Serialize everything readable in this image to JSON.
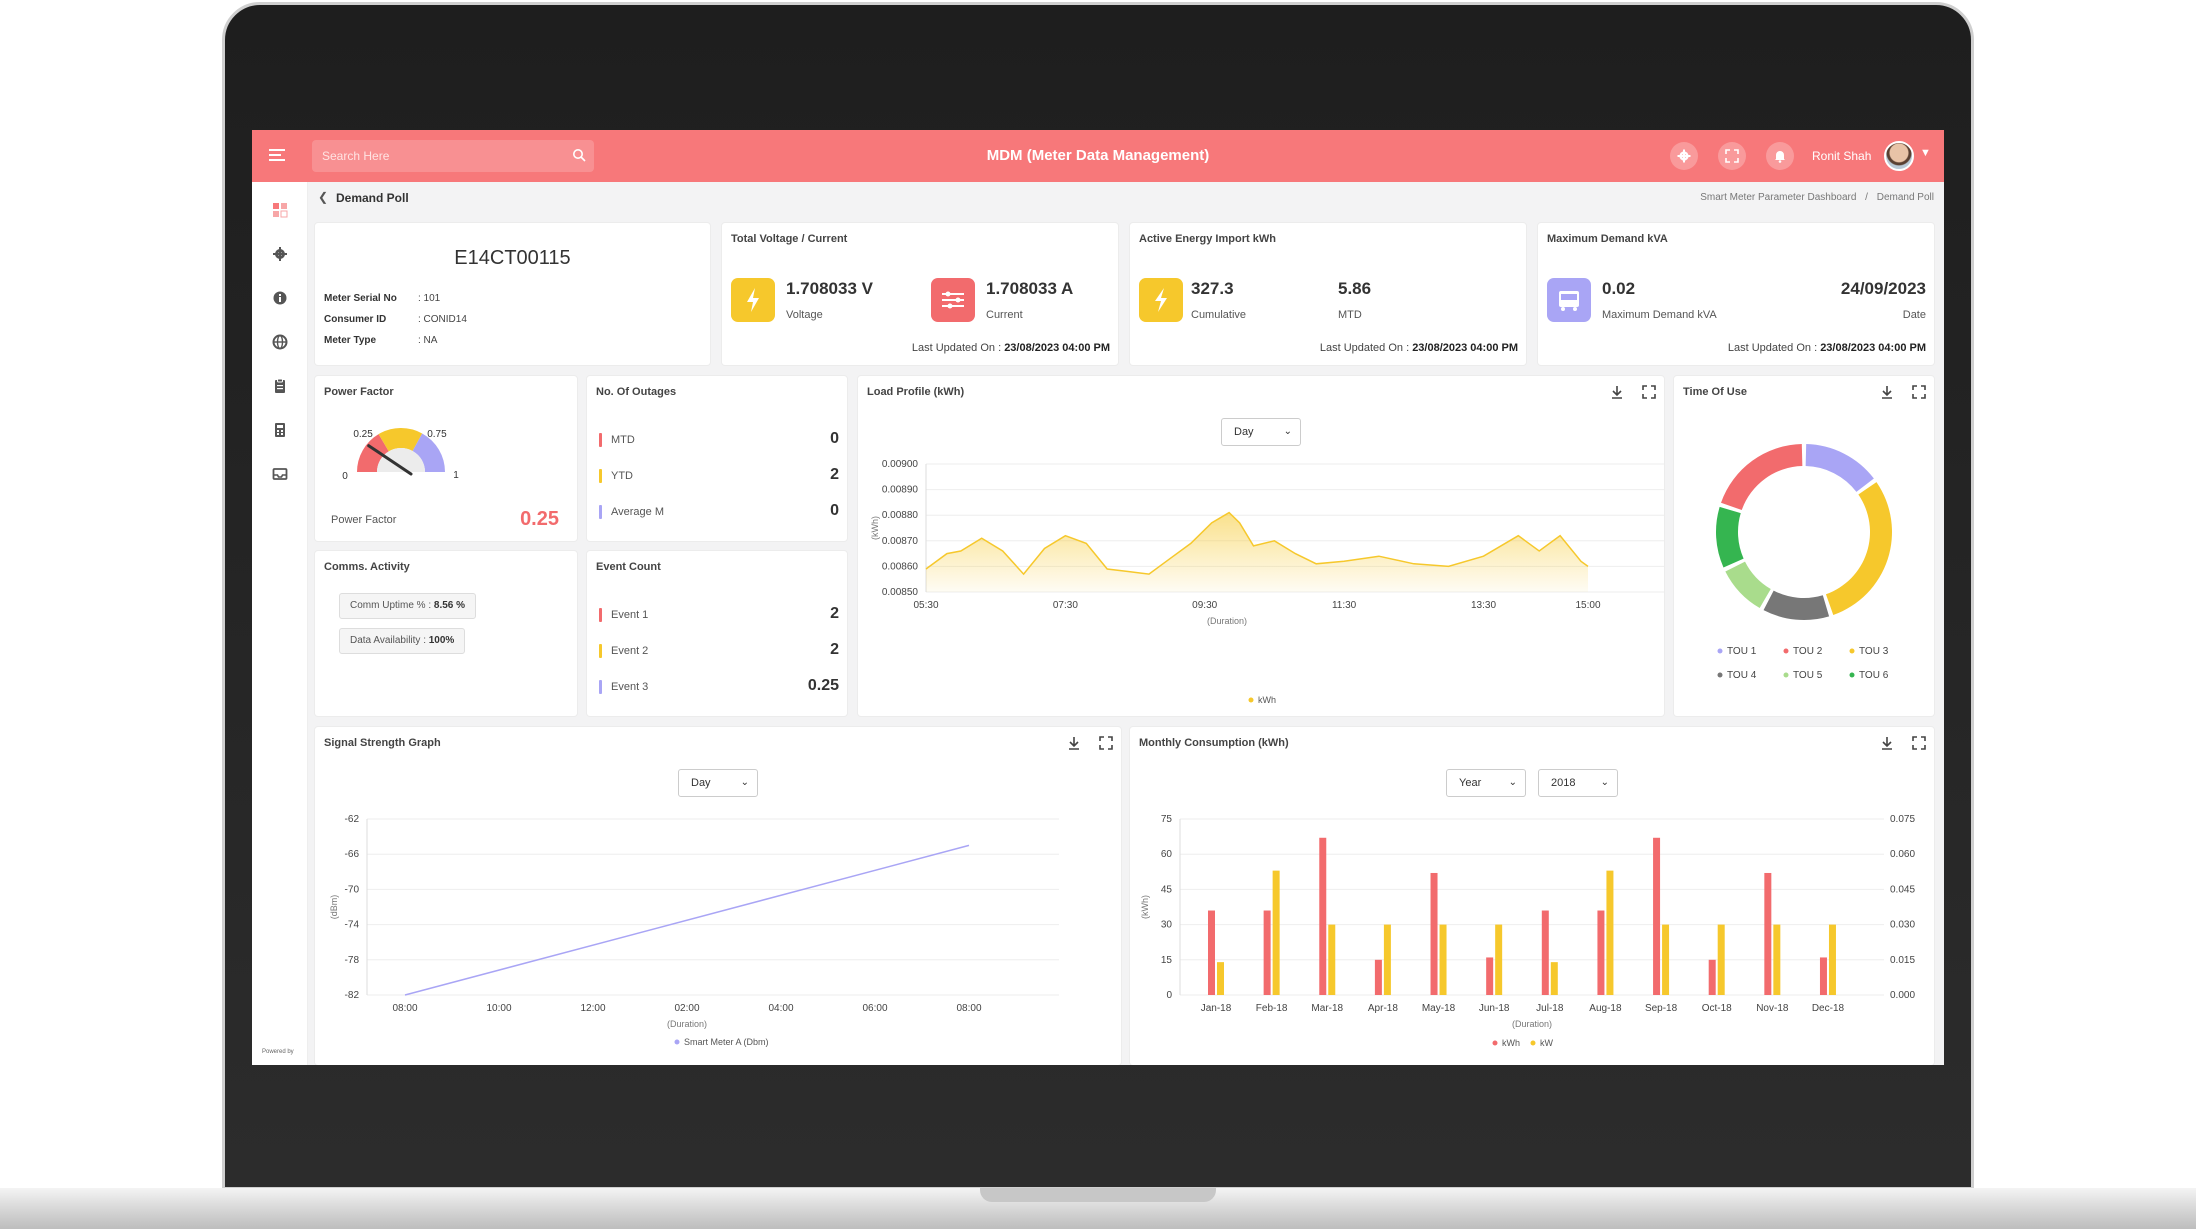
{
  "app": {
    "title": "MDM (Meter Data Management)",
    "search_placeholder": "Search Here",
    "user_name": "Ronit Shah",
    "page_title": "Demand Poll",
    "breadcrumb": [
      "Smart Meter Parameter Dashboard",
      "/",
      "Demand Poll"
    ],
    "powered_by": "Powered by",
    "icons": {
      "menu": "hamburger-menu-icon",
      "search": "search-icon",
      "settings": "gear-icon",
      "fullscreen": "fullscreen-icon",
      "notifications": "bell-icon",
      "dropdown": "chevron-down-icon",
      "back": "chevron-left-icon",
      "sidebar": [
        "dashboard-icon",
        "gear-icon",
        "info-icon",
        "globe-icon",
        "clipboard-icon",
        "calculator-icon",
        "inbox-icon"
      ]
    }
  },
  "colors": {
    "accent": "#f7787a",
    "yellow": "#f6c82c",
    "red": "#f26b6d",
    "purple": "#a9a5f5",
    "green": "#35b550",
    "lightgreen": "#a9dc8c",
    "gray": "#777777"
  },
  "meter": {
    "serial_title": "E14CT00115",
    "fields": [
      {
        "label": "Meter Serial No",
        "value": ": 101"
      },
      {
        "label": "Consumer ID",
        "value": ": CONID14"
      },
      {
        "label": "Meter Type",
        "value": ": NA"
      }
    ]
  },
  "voltage_card": {
    "title": "Total Voltage / Current",
    "voltage_value": "1.708033 V",
    "voltage_label": "Voltage",
    "current_value": "1.708033 A",
    "current_label": "Current",
    "updated_label": "Last Updated On :",
    "updated_value": "23/08/2023 04:00 PM"
  },
  "energy_card": {
    "title": "Active Energy Import kWh",
    "cumulative_value": "327.3",
    "cumulative_label": "Cumulative",
    "mtd_value": "5.86",
    "mtd_label": "MTD",
    "updated_label": "Last Updated On :",
    "updated_value": "23/08/2023 04:00 PM"
  },
  "demand_card": {
    "title": "Maximum Demand kVA",
    "value": "0.02",
    "value_label": "Maximum Demand kVA",
    "date_value": "24/09/2023",
    "date_label": "Date",
    "updated_label": "Last Updated On :",
    "updated_value": "23/08/2023 04:00 PM"
  },
  "power_factor": {
    "title": "Power Factor",
    "gauge_ticks": [
      "0",
      "0.25",
      "0.75",
      "1"
    ],
    "needle_value": 0.25,
    "label": "Power Factor",
    "value": "0.25"
  },
  "outages": {
    "title": "No. Of Outages",
    "rows": [
      {
        "label": "MTD",
        "value": "0"
      },
      {
        "label": "YTD",
        "value": "2"
      },
      {
        "label": "Average M",
        "value": "0"
      }
    ]
  },
  "comms": {
    "title": "Comms. Activity",
    "uptime_label": "Comm Uptime % :",
    "uptime_value": "8.56 %",
    "availability_label": "Data Availability :",
    "availability_value": "100%"
  },
  "events": {
    "title": "Event Count",
    "rows": [
      {
        "label": "Event 1",
        "value": "2"
      },
      {
        "label": "Event 2",
        "value": "2"
      },
      {
        "label": "Event 3",
        "value": "0.25"
      }
    ]
  },
  "load_profile": {
    "title": "Load Profile (kWh)",
    "period": "Day",
    "x_axis_title": "(Duration)",
    "y_axis_title": "(kWh)",
    "legend": "kWh"
  },
  "time_of_use": {
    "title": "Time Of Use",
    "legend": [
      "TOU 1",
      "TOU 2",
      "TOU 3",
      "TOU 4",
      "TOU 5",
      "TOU 6"
    ]
  },
  "signal": {
    "title": "Signal Strength Graph",
    "period": "Day",
    "x_axis_title": "(Duration)",
    "y_axis_title": "(dBm)",
    "legend": "Smart Meter A (Dbm)"
  },
  "monthly": {
    "title": "Monthly Consumption (kWh)",
    "period": "Year",
    "year": "2018",
    "x_axis_title": "(Duration)",
    "y_axis_title": "(kWh)",
    "legend": [
      "kWh",
      "kW"
    ]
  },
  "chart_data": [
    {
      "type": "gauge",
      "ticks": [
        "0",
        "0.25",
        "0.75",
        "1"
      ],
      "bands": [
        {
          "from": 0,
          "to": 0.33,
          "color": "#f26b6d"
        },
        {
          "from": 0.33,
          "to": 0.66,
          "color": "#f6c82c"
        },
        {
          "from": 0.66,
          "to": 1,
          "color": "#a9a5f5"
        }
      ],
      "value": 0.25
    },
    {
      "type": "area",
      "x_ticks": [
        "05:30",
        "07:30",
        "09:30",
        "11:30",
        "13:30",
        "15:00"
      ],
      "x_hours": [
        5.5,
        7.5,
        9.5,
        11.5,
        13.5,
        15.0
      ],
      "y_ticks": [
        "0.00900",
        "0.00890",
        "0.00880",
        "0.00870",
        "0.00860",
        "0.00850"
      ],
      "ylim": [
        0.0085,
        0.009
      ],
      "xlim": [
        5.5,
        15.0
      ],
      "xlabel": "(Duration)",
      "ylabel": "(kWh)",
      "series": [
        {
          "name": "kWh",
          "color": "#f6c82c",
          "x": [
            5.5,
            5.8,
            6.0,
            6.3,
            6.6,
            6.9,
            7.2,
            7.5,
            7.8,
            8.1,
            8.4,
            8.7,
            9.0,
            9.3,
            9.6,
            9.85,
            10.0,
            10.2,
            10.5,
            10.8,
            11.1,
            11.5,
            12.0,
            12.5,
            13.0,
            13.5,
            14.0,
            14.3,
            14.6,
            14.9,
            15.0
          ],
          "y": [
            0.00859,
            0.00865,
            0.00866,
            0.00871,
            0.00866,
            0.00857,
            0.00867,
            0.00872,
            0.00869,
            0.00859,
            0.00858,
            0.00857,
            0.00863,
            0.00869,
            0.00877,
            0.00881,
            0.00877,
            0.00868,
            0.0087,
            0.00865,
            0.00861,
            0.00862,
            0.00864,
            0.00861,
            0.0086,
            0.00864,
            0.00872,
            0.00866,
            0.00872,
            0.00862,
            0.0086
          ]
        }
      ]
    },
    {
      "type": "pie",
      "variant": "donut",
      "categories": [
        "TOU 1",
        "TOU 2",
        "TOU 3",
        "TOU 4",
        "TOU 5",
        "TOU 6"
      ],
      "values": [
        15,
        20,
        30,
        13,
        10,
        12
      ],
      "order_clockwise_from_top": [
        "TOU 1",
        "TOU 3",
        "TOU 4",
        "TOU 5",
        "TOU 6",
        "TOU 2"
      ],
      "colors": {
        "TOU 1": "#a9a5f5",
        "TOU 2": "#f26b6d",
        "TOU 3": "#f6c82c",
        "TOU 4": "#777777",
        "TOU 5": "#a9dc8c",
        "TOU 6": "#35b550"
      }
    },
    {
      "type": "line",
      "x_ticks": [
        "08:00",
        "10:00",
        "12:00",
        "02:00",
        "04:00",
        "06:00",
        "08:00"
      ],
      "y_ticks": [
        "-62",
        "-66",
        "-70",
        "-74",
        "-78",
        "-82"
      ],
      "ylim": [
        -82,
        -62
      ],
      "xlabel": "(Duration)",
      "ylabel": "(dBm)",
      "series": [
        {
          "name": "Smart Meter A (Dbm)",
          "color": "#a9a5f5",
          "x_index": [
            0,
            6
          ],
          "y": [
            -82,
            -65
          ]
        }
      ]
    },
    {
      "type": "bar",
      "categories": [
        "Jan-18",
        "Feb-18",
        "Mar-18",
        "Apr-18",
        "May-18",
        "Jun-18",
        "Jul-18",
        "Aug-18",
        "Sep-18",
        "Oct-18",
        "Nov-18",
        "Dec-18"
      ],
      "xlabel": "(Duration)",
      "ylabel": "(kWh)",
      "y_ticks_left": [
        "75",
        "60",
        "45",
        "30",
        "15",
        "0"
      ],
      "y_ticks_right": [
        "0.075",
        "0.060",
        "0.045",
        "0.030",
        "0.015",
        "0.000"
      ],
      "ylim": [
        0,
        75
      ],
      "ylim_right": [
        0,
        0.075
      ],
      "series": [
        {
          "name": "kWh",
          "color": "#f26b6d",
          "axis": "left",
          "values": [
            36,
            36,
            67,
            15,
            52,
            16,
            36,
            36,
            67,
            15,
            52,
            16
          ]
        },
        {
          "name": "kW",
          "color": "#f6c82c",
          "axis": "right",
          "values": [
            0.014,
            0.053,
            0.03,
            0.03,
            0.03,
            0.03,
            0.014,
            0.053,
            0.03,
            0.03,
            0.03,
            0.03
          ]
        }
      ]
    }
  ]
}
